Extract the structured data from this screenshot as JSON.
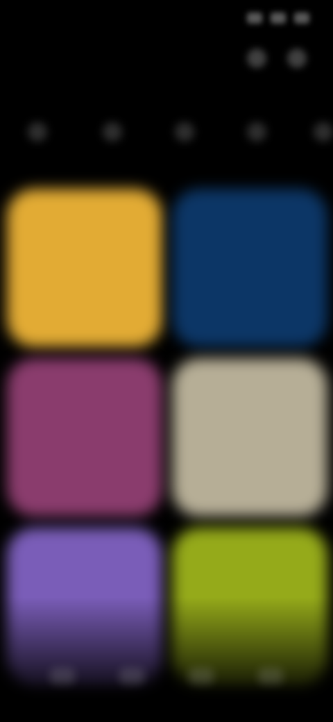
{
  "status_bar": {
    "time": "",
    "icons": [
      "signal-icon",
      "wifi-icon",
      "battery-icon"
    ]
  },
  "header": {
    "title": "",
    "actions": [
      "search-icon",
      "more-icon"
    ]
  },
  "tabs": [
    {
      "icon": "tab-icon-1"
    },
    {
      "icon": "tab-icon-2"
    },
    {
      "icon": "tab-icon-3"
    },
    {
      "icon": "tab-icon-4"
    },
    {
      "icon": "tab-icon-5"
    }
  ],
  "tiles": [
    {
      "color": "#e2ab34",
      "label": "",
      "sub": ""
    },
    {
      "color": "#0c3666",
      "label": "",
      "sub": ""
    },
    {
      "color": "#8a3c6d",
      "label": "",
      "sub": ""
    },
    {
      "color": "#b6ae96",
      "label": "",
      "sub": ""
    },
    {
      "color": "#7a5db8",
      "label": "",
      "sub": ""
    },
    {
      "color": "#95aa1a",
      "label": "",
      "sub": ""
    }
  ],
  "nav": [
    {
      "icon": "nav-icon-1"
    },
    {
      "icon": "nav-icon-2"
    },
    {
      "icon": "nav-icon-3"
    },
    {
      "icon": "nav-icon-4"
    }
  ]
}
